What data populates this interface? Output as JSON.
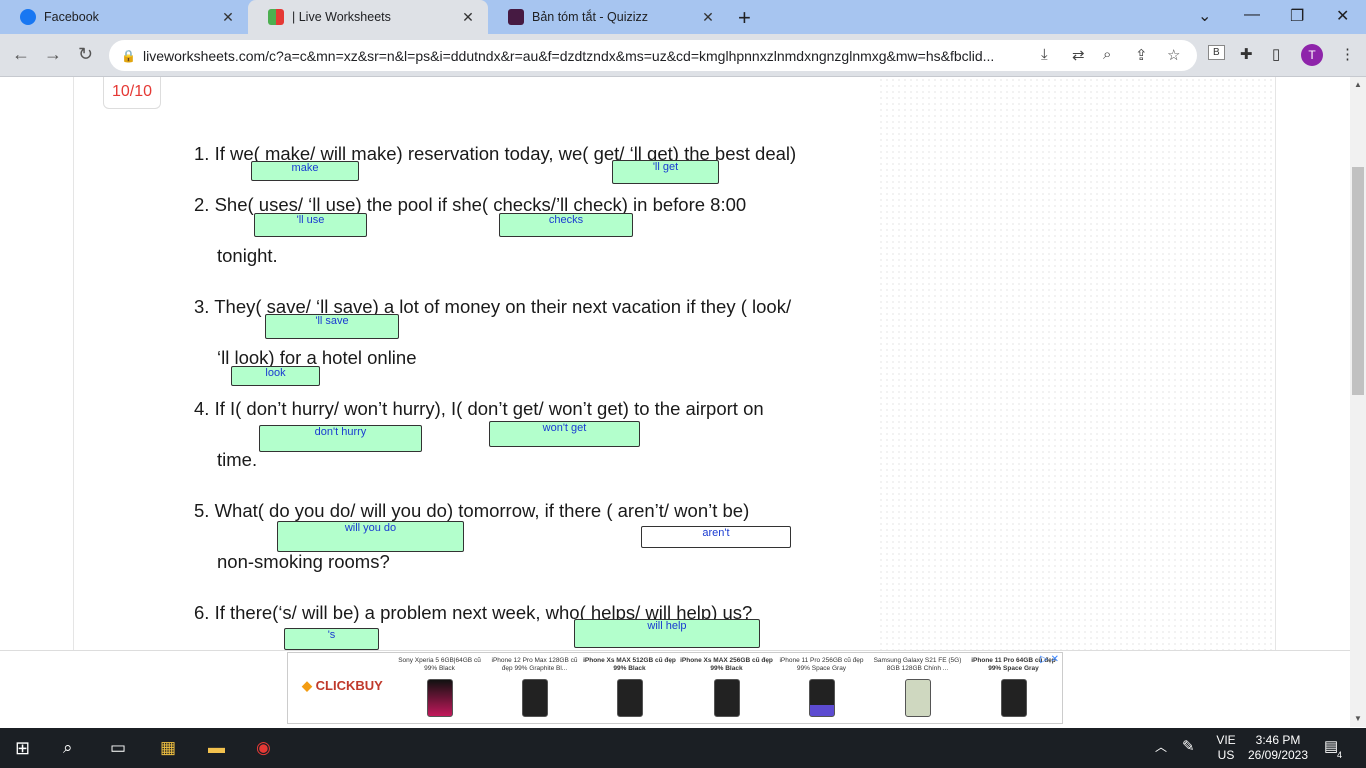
{
  "browser": {
    "tabs": [
      {
        "title": "Facebook",
        "favicon_color": "#1877f2"
      },
      {
        "title": "| Live Worksheets",
        "favicon_color": "#4caf50"
      },
      {
        "title": "Bản tóm tắt - Quizizz",
        "favicon_color": "#461a42"
      }
    ],
    "url": "liveworksheets.com/c?a=c&mn=xz&sr=n&l=ps&i=ddutndx&r=au&f=dzdtzndx&ms=uz&cd=kmglhpnnxzlnmdxngnzglnmxg&mw=hs&fbclid...",
    "profile_initial": "T",
    "ext_label": "B"
  },
  "worksheet": {
    "score": "10/10",
    "lines": [
      "1.  If we( make/ will make) reservation today, we( get/ ‘ll get) the best deal)",
      "2.  She( uses/ ‘ll use) the pool if she( checks/’ll check)  in before 8:00",
      "tonight.",
      "3.  They( save/ ‘ll save) a lot of money on their next vacation if they ( look/",
      "‘ll look) for a hotel online",
      "4.  If I( don’t hurry/ won’t hurry), I( don’t get/ won’t get) to the airport on",
      "time.",
      "5.  What( do you do/ will you do) tomorrow, if there ( aren’t/ won’t be)",
      "non-smoking rooms?",
      "6.  If there(‘s/ will be) a problem next week, who( helps/ will help) us?"
    ],
    "answers": [
      "make",
      "'ll get",
      "'ll use",
      "checks",
      "'ll save",
      "look",
      "don't hurry",
      "won't get",
      "will you do",
      "aren't",
      "'s",
      "will help"
    ]
  },
  "ad": {
    "brand": "CLICKBUY",
    "products": [
      "Sony Xperia 5 6GB|64GB cũ 99% Black",
      "iPhone 12 Pro Max 128GB cũ đẹp 99% Graphite Bl...",
      "iPhone Xs MAX 512GB cũ đẹp 99% Black",
      "iPhone Xs MAX 256GB cũ đẹp 99% Black",
      "iPhone 11 Pro 256GB cũ đẹp 99% Space Gray",
      "Samsung Galaxy S21 FE (5G) 8GB 128GB Chính ...",
      "iPhone 11 Pro 64GB cũ đẹp 99% Space Gray"
    ]
  },
  "taskbar": {
    "lang_top": "VIE",
    "lang_bottom": "US",
    "time": "3:46 PM",
    "date": "26/09/2023",
    "notif_count": "4"
  }
}
